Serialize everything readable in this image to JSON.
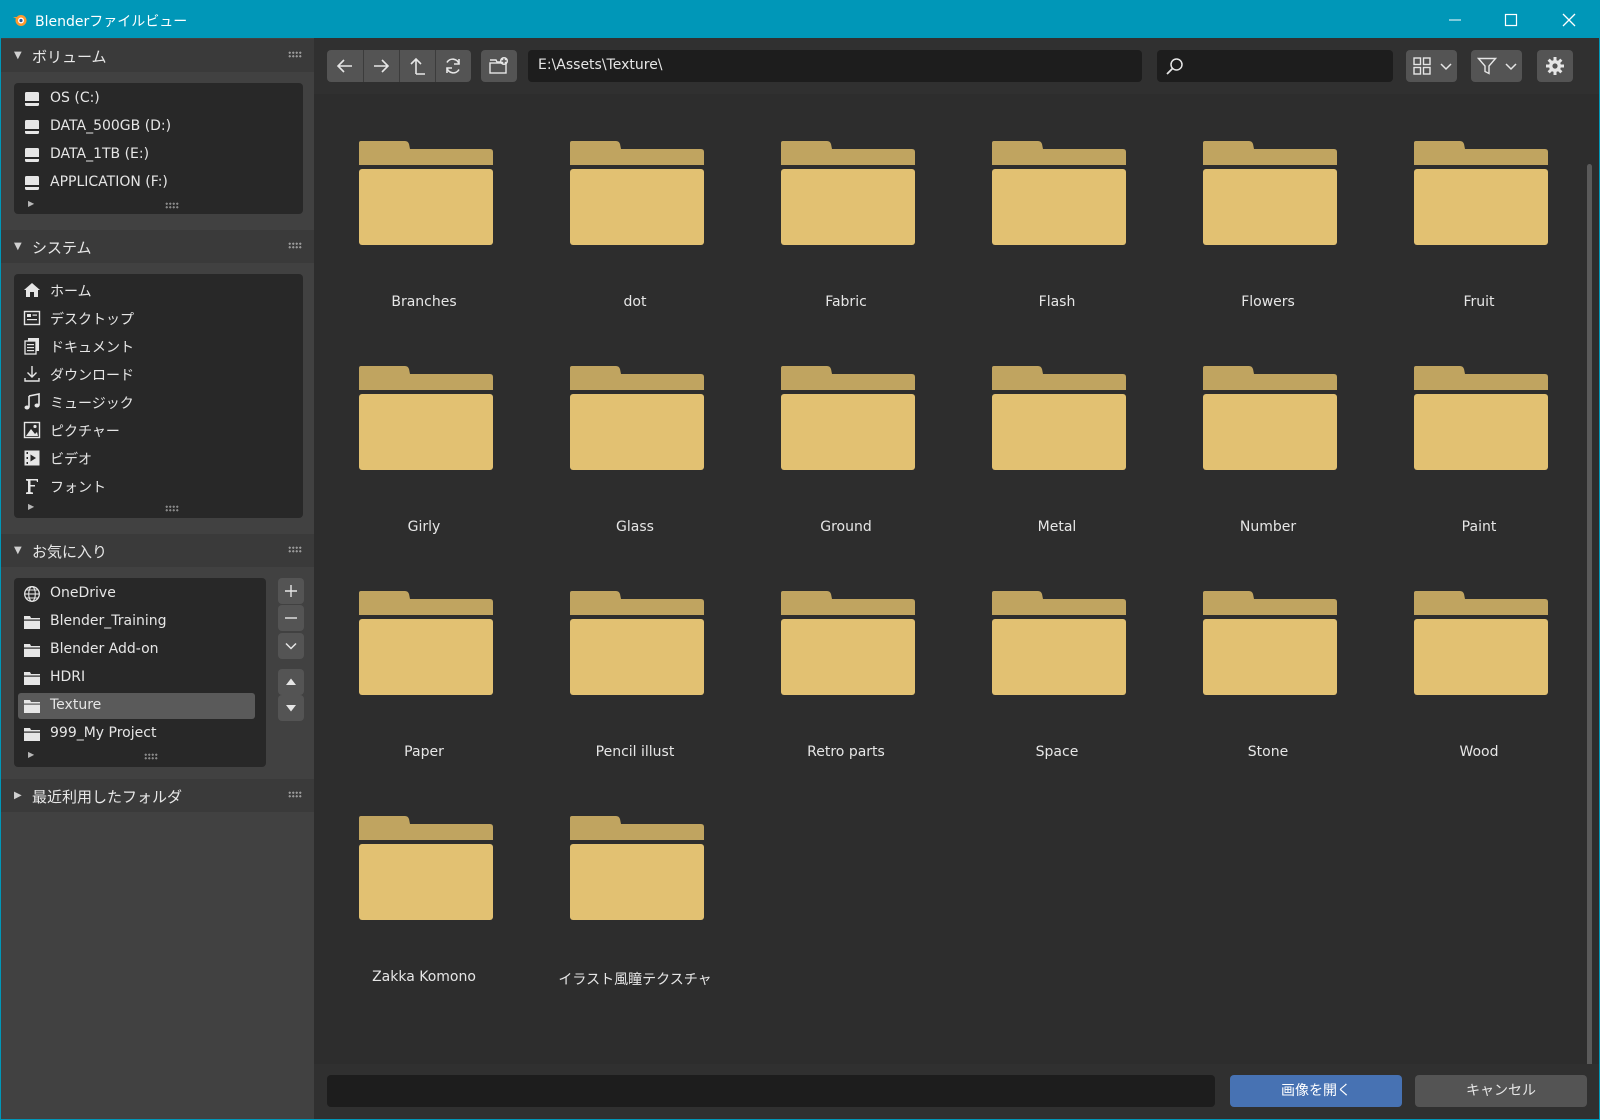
{
  "window": {
    "title": "Blenderファイルビュー"
  },
  "sidebar": {
    "volumes": {
      "title": "ボリューム",
      "items": [
        {
          "label": "OS (C:)",
          "icon": "drive-icon"
        },
        {
          "label": "DATA_500GB (D:)",
          "icon": "drive-icon"
        },
        {
          "label": "DATA_1TB (E:)",
          "icon": "drive-icon"
        },
        {
          "label": "APPLICATION (F:)",
          "icon": "drive-icon"
        }
      ]
    },
    "system": {
      "title": "システム",
      "items": [
        {
          "label": "ホーム",
          "icon": "home-icon"
        },
        {
          "label": "デスクトップ",
          "icon": "desktop-icon"
        },
        {
          "label": "ドキュメント",
          "icon": "documents-icon"
        },
        {
          "label": "ダウンロード",
          "icon": "download-icon"
        },
        {
          "label": "ミュージック",
          "icon": "music-icon"
        },
        {
          "label": "ピクチャー",
          "icon": "pictures-icon"
        },
        {
          "label": "ビデオ",
          "icon": "video-icon"
        },
        {
          "label": "フォント",
          "icon": "font-icon"
        }
      ]
    },
    "favorites": {
      "title": "お気に入り",
      "items": [
        {
          "label": "OneDrive",
          "icon": "globe-icon",
          "selected": false
        },
        {
          "label": "Blender_Training",
          "icon": "folder-icon",
          "selected": false
        },
        {
          "label": "Blender Add-on",
          "icon": "folder-icon",
          "selected": false
        },
        {
          "label": "HDRI",
          "icon": "folder-icon",
          "selected": false
        },
        {
          "label": "Texture",
          "icon": "folder-icon",
          "selected": true
        },
        {
          "label": "999_My Project",
          "icon": "folder-icon",
          "selected": false
        }
      ]
    },
    "recent": {
      "title": "最近利用したフォルダ"
    }
  },
  "toolbar": {
    "path": "E:\\Assets\\Texture\\",
    "search_value": ""
  },
  "files": [
    "Branches",
    "dot",
    "Fabric",
    "Flash",
    "Flowers",
    "Fruit",
    "Girly",
    "Glass",
    "Ground",
    "Metal",
    "Number",
    "Paint",
    "Paper",
    "Pencil illust",
    "Retro parts",
    "Space",
    "Stone",
    "Wood",
    "Zakka Komono",
    "イラスト風瞳テクスチャ"
  ],
  "footer": {
    "filename_value": "",
    "open_label": "画像を開く",
    "cancel_label": "キャンセル"
  },
  "colors": {
    "titlebar": "#0097b8",
    "folder_body": "#e2c172",
    "folder_tab": "#c0a460",
    "accent_button": "#4772b3"
  }
}
